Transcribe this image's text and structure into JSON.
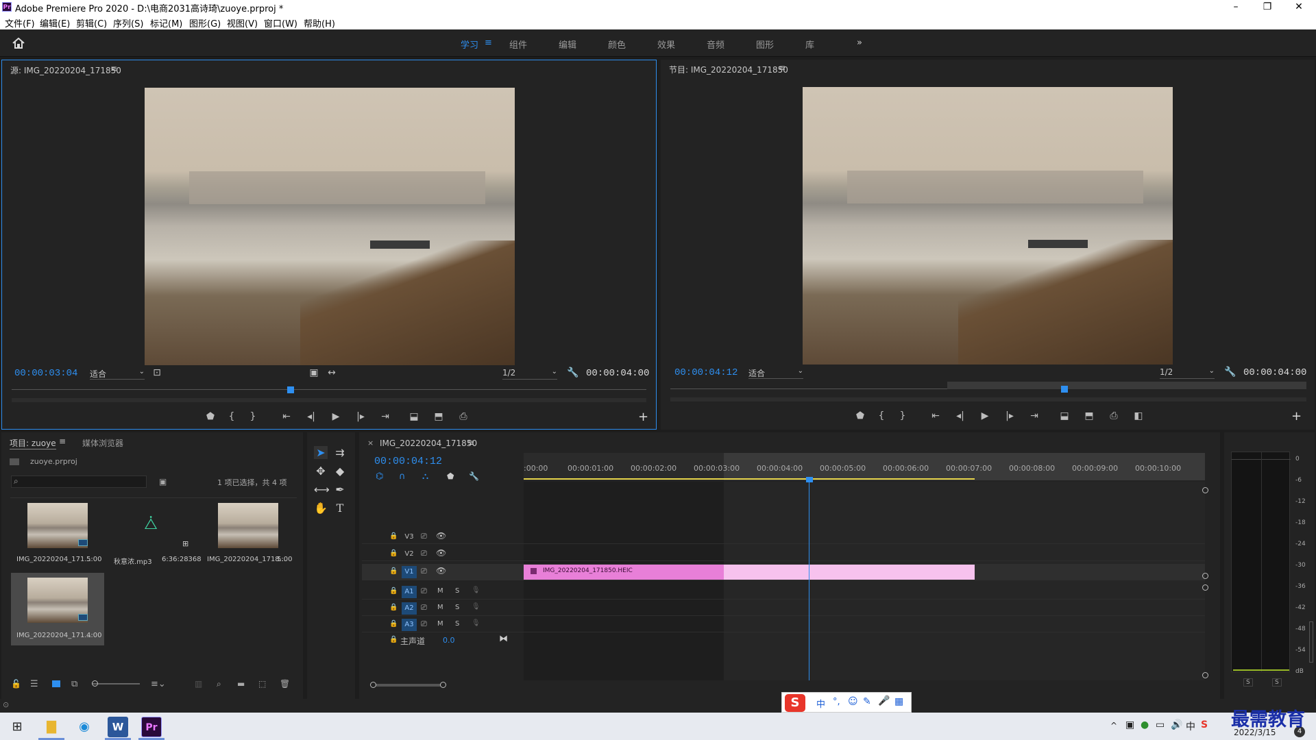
{
  "app": {
    "title": "Adobe Premiere Pro 2020 - D:\\电商2031高诗琦\\zuoye.prproj *",
    "logo": "Pr"
  },
  "window_controls": {
    "minimize": "–",
    "restore": "❐",
    "close": "✕"
  },
  "menu": [
    "文件(F)",
    "编辑(E)",
    "剪辑(C)",
    "序列(S)",
    "标记(M)",
    "图形(G)",
    "视图(V)",
    "窗口(W)",
    "帮助(H)"
  ],
  "workspaces": {
    "items": [
      "学习",
      "组件",
      "编辑",
      "颜色",
      "效果",
      "音频",
      "图形",
      "库"
    ],
    "active": "学习",
    "more": "»"
  },
  "source_monitor": {
    "title": "源: IMG_20220204_171850",
    "timecode": "00:00:03:04",
    "fit": "适合",
    "resolution": "1/2",
    "duration": "00:00:04:00",
    "playhead_fraction": 0.44
  },
  "program_monitor": {
    "title": "节目: IMG_20220204_171850",
    "timecode": "00:00:04:12",
    "fit": "适合",
    "resolution": "1/2",
    "duration": "00:00:04:00",
    "playhead_fraction": 0.62
  },
  "project": {
    "tab_project": "项目: zuoye",
    "tab_media": "媒体浏览器",
    "file": "zuoye.prproj",
    "selection": "1 项已选择，共 4 项",
    "items": [
      {
        "name": "IMG_20220204_171...",
        "duration": "5:00",
        "kind": "video"
      },
      {
        "name": "秋意浓.mp3",
        "duration": "6:36:28368",
        "kind": "audio"
      },
      {
        "name": "IMG_20220204_1718...",
        "duration": "5:00",
        "kind": "video"
      },
      {
        "name": "IMG_20220204_171...",
        "duration": "4:00",
        "kind": "video"
      }
    ]
  },
  "timeline": {
    "sequence_tab": "IMG_20220204_171850",
    "timecode": "00:00:04:12",
    "ruler": [
      ":00:00",
      "00:00:01:00",
      "00:00:02:00",
      "00:00:03:00",
      "00:00:04:00",
      "00:00:05:00",
      "00:00:06:00",
      "00:00:07:00",
      "00:00:08:00",
      "00:00:09:00",
      "00:00:10:00"
    ],
    "video_tracks": [
      "V3",
      "V2",
      "V1"
    ],
    "audio_tracks": [
      "A1",
      "A2",
      "A3"
    ],
    "mix_label": "主声道",
    "mix_value": "0.0",
    "track_btn_m": "M",
    "track_btn_s": "S",
    "clip_label": "IMG_20220204_171850.HEIC"
  },
  "audio_meter": {
    "scale": [
      "0",
      "-6",
      "-12",
      "-18",
      "-24",
      "-30",
      "-36",
      "-42",
      "-48",
      "-54",
      "dB"
    ],
    "solo": [
      "S",
      "S"
    ]
  },
  "ime_bar": {
    "items": [
      "中",
      "°,",
      "☺",
      "✎",
      "🎤",
      "▦"
    ]
  },
  "tray": {
    "date": "2022/3/15",
    "badge": "4"
  },
  "watermark": "最需教育",
  "colors": {
    "accent": "#2e8ff0",
    "clip": "#e87fd8",
    "clip_light": "#f7c2ee",
    "track_on": "#1d4a78"
  },
  "icons": {
    "home": "home-icon",
    "search": "search-icon",
    "wrench": "wrench-icon",
    "play": "play-icon"
  }
}
